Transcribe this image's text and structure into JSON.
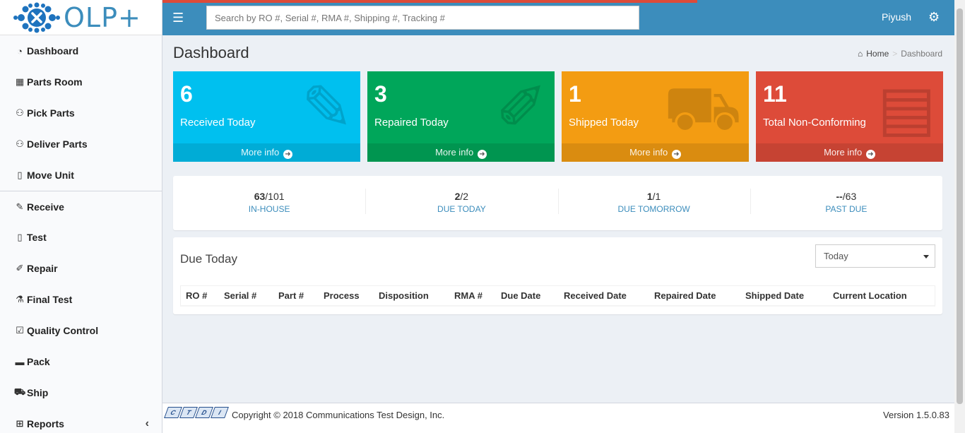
{
  "app": {
    "logo_text": "OLP+"
  },
  "search": {
    "placeholder": "Search by RO #, Serial #, RMA #, Shipping #, Tracking #"
  },
  "header": {
    "user": "Piyush"
  },
  "sidebar": {
    "items": [
      {
        "label": "Dashboard",
        "icon": "tachometer-icon"
      },
      {
        "label": "Parts Room",
        "icon": "store-icon"
      },
      {
        "label": "Pick Parts",
        "icon": "people-carry-icon"
      },
      {
        "label": "Deliver Parts",
        "icon": "people-carry-icon"
      },
      {
        "label": "Move Unit",
        "icon": "move-icon"
      },
      {
        "label": "Receive",
        "icon": "edit-icon"
      },
      {
        "label": "Test",
        "icon": "test-icon"
      },
      {
        "label": "Repair",
        "icon": "wrench-icon"
      },
      {
        "label": "Final Test",
        "icon": "flask-icon"
      },
      {
        "label": "Quality Control",
        "icon": "clipboard-check-icon"
      },
      {
        "label": "Pack",
        "icon": "box-icon"
      },
      {
        "label": "Ship",
        "icon": "truck-icon"
      },
      {
        "label": "Reports",
        "icon": "table-icon"
      }
    ]
  },
  "page": {
    "title": "Dashboard",
    "breadcrumb": {
      "home": "Home",
      "current": "Dashboard"
    }
  },
  "boxes": [
    {
      "value": "6",
      "label": "Received Today",
      "more": "More info",
      "color": "#00c0ef",
      "icon": "edit-icon"
    },
    {
      "value": "3",
      "label": "Repaired Today",
      "more": "More info",
      "color": "#00a65a",
      "icon": "wrench-icon"
    },
    {
      "value": "1",
      "label": "Shipped Today",
      "more": "More info",
      "color": "#f39c12",
      "icon": "truck-icon"
    },
    {
      "value": "11",
      "label": "Total Non-Conforming",
      "more": "More info",
      "color": "#dd4b39",
      "icon": "file-icon"
    }
  ],
  "stats": [
    {
      "bold": "63",
      "rest": "/101",
      "key": "IN-HOUSE"
    },
    {
      "bold": "2",
      "rest": "/2",
      "key": "DUE TODAY"
    },
    {
      "bold": "1",
      "rest": "/1",
      "key": "DUE TOMORROW"
    },
    {
      "bold": "--",
      "rest": "/63",
      "key": "PAST DUE"
    }
  ],
  "due_today": {
    "title": "Due Today",
    "filter_selected": "Today",
    "columns": [
      "RO #",
      "Serial #",
      "Part #",
      "Process",
      "Disposition",
      "RMA #",
      "Due Date",
      "Received Date",
      "Repaired Date",
      "Shipped Date",
      "Current Location"
    ]
  },
  "footer": {
    "logo_letters": [
      "C",
      "T",
      "D",
      "I"
    ],
    "copyright": "Copyright © 2018 Communications Test Design, Inc.",
    "version": "Version 1.5.0.83"
  }
}
